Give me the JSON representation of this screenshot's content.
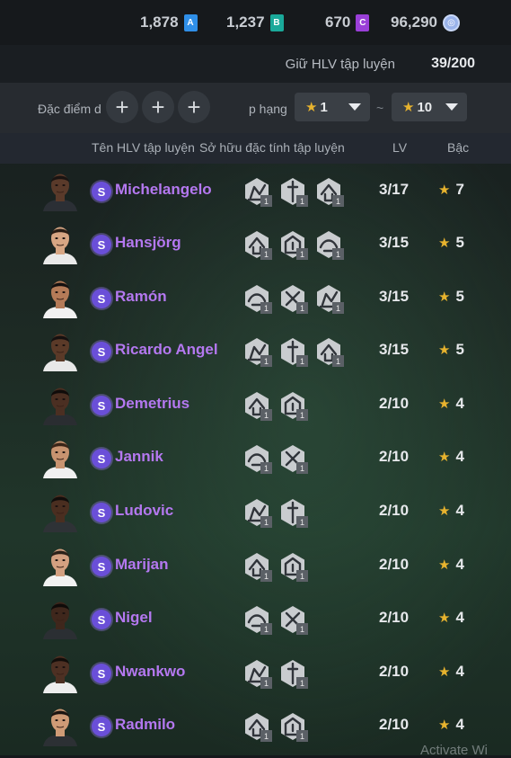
{
  "currencies": [
    {
      "value": "1,878",
      "badge": "A",
      "color": "#2f8fe8"
    },
    {
      "value": "1,237",
      "badge": "B",
      "color": "#1aa99a"
    },
    {
      "value": "670",
      "badge": "C",
      "color": "#9a3fd8"
    },
    {
      "value": "96,290",
      "badge": "",
      "color": "#9ab3ea",
      "icon": "coin-icon"
    }
  ],
  "capacity": {
    "label": "Giữ HLV tập luyện",
    "value": "39/200"
  },
  "filters": {
    "trait_label": "Đặc điểm d",
    "rank_label": "p hạng",
    "from_value": "1",
    "to_value": "10",
    "separator": "~"
  },
  "columns": {
    "name": "Tên HLV tập luyện",
    "traits": "Sở hữu đặc tính tập luyện",
    "lv": "LV",
    "grade": "Bậc"
  },
  "coaches": [
    {
      "name": "Michelangelo",
      "lv": "3/17",
      "grade": "7",
      "traits": [
        "1",
        "1",
        "1"
      ],
      "skin": "#5a3a2a",
      "hair": "#1a1412",
      "shirt": "#2b2f35"
    },
    {
      "name": "Hansjörg",
      "lv": "3/15",
      "grade": "5",
      "traits": [
        "1",
        "1",
        "1"
      ],
      "skin": "#d7a684",
      "hair": "#2a1d15",
      "shirt": "#e9e9e9"
    },
    {
      "name": "Ramón",
      "lv": "3/15",
      "grade": "5",
      "traits": [
        "1",
        "1",
        "1"
      ],
      "skin": "#b47b58",
      "hair": "#141010",
      "shirt": "#f1f1f1"
    },
    {
      "name": "Ricardo Angel",
      "lv": "3/15",
      "grade": "5",
      "traits": [
        "1",
        "1",
        "1"
      ],
      "skin": "#5b3a28",
      "hair": "#151010",
      "shirt": "#e8e8e8"
    },
    {
      "name": "Demetrius",
      "lv": "2/10",
      "grade": "4",
      "traits": [
        "1",
        "1"
      ],
      "skin": "#4b2f22",
      "hair": "#100c0a",
      "shirt": "#2a2d31"
    },
    {
      "name": "Jannik",
      "lv": "2/10",
      "grade": "4",
      "traits": [
        "1",
        "1"
      ],
      "skin": "#c89470",
      "hair": "#3a2518",
      "shirt": "#f0f0f0"
    },
    {
      "name": "Ludovic",
      "lv": "2/10",
      "grade": "4",
      "traits": [
        "1",
        "1"
      ],
      "skin": "#4a2e20",
      "hair": "#110d0b",
      "shirt": "#2e3236"
    },
    {
      "name": "Marijan",
      "lv": "2/10",
      "grade": "4",
      "traits": [
        "1",
        "1"
      ],
      "skin": "#d3a081",
      "hair": "#2b2119",
      "shirt": "#f2f2f2"
    },
    {
      "name": "Nigel",
      "lv": "2/10",
      "grade": "4",
      "traits": [
        "1",
        "1"
      ],
      "skin": "#3f271c",
      "hair": "#0f0b09",
      "shirt": "#2b2f33"
    },
    {
      "name": "Nwankwo",
      "lv": "2/10",
      "grade": "4",
      "traits": [
        "1",
        "1"
      ],
      "skin": "#4d3023",
      "hair": "#120d0a",
      "shirt": "#ededed"
    },
    {
      "name": "Radmilo",
      "lv": "2/10",
      "grade": "4",
      "traits": [
        "1",
        "1"
      ],
      "skin": "#cf9b76",
      "hair": "#1c1511",
      "shirt": "#2c3034"
    }
  ],
  "watermark": "Activate Wi"
}
